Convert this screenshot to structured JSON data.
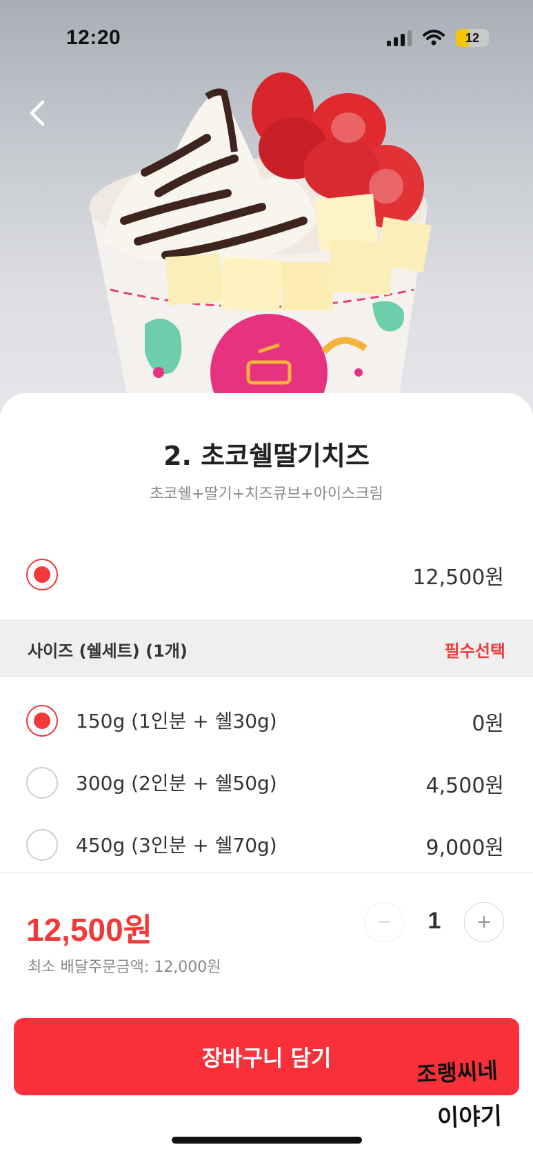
{
  "status_bar": {
    "time": "12:20",
    "battery": "12"
  },
  "product": {
    "title": "2. 초코쉘딸기치즈",
    "description": "초코쉘+딸기+치즈큐브+아이스크림",
    "base_price": "12,500원"
  },
  "size_section": {
    "title": "사이즈 (쉘세트) (1개)",
    "badge": "필수선택",
    "options": [
      {
        "label": "150g (1인분 + 쉘30g)",
        "price": "0원",
        "selected": true
      },
      {
        "label": "300g (2인분 + 쉘50g)",
        "price": "4,500원",
        "selected": false
      },
      {
        "label": "450g (3인분 + 쉘70g)",
        "price": "9,000원",
        "selected": false
      }
    ]
  },
  "footer": {
    "total_price": "12,500원",
    "min_order": "최소 배달주문금액: 12,000원",
    "quantity": "1",
    "minus_symbol": "−",
    "plus_symbol": "+",
    "cart_button": "장바구니 담기"
  },
  "watermark": {
    "line1": "조랭씨네",
    "line2": "이야기"
  },
  "colors": {
    "accent": "#f03a3a",
    "button": "#f7303a"
  },
  "icons": {
    "back": "chevron-left-icon",
    "wifi": "wifi-icon",
    "signal": "signal-icon",
    "battery": "battery-icon"
  }
}
